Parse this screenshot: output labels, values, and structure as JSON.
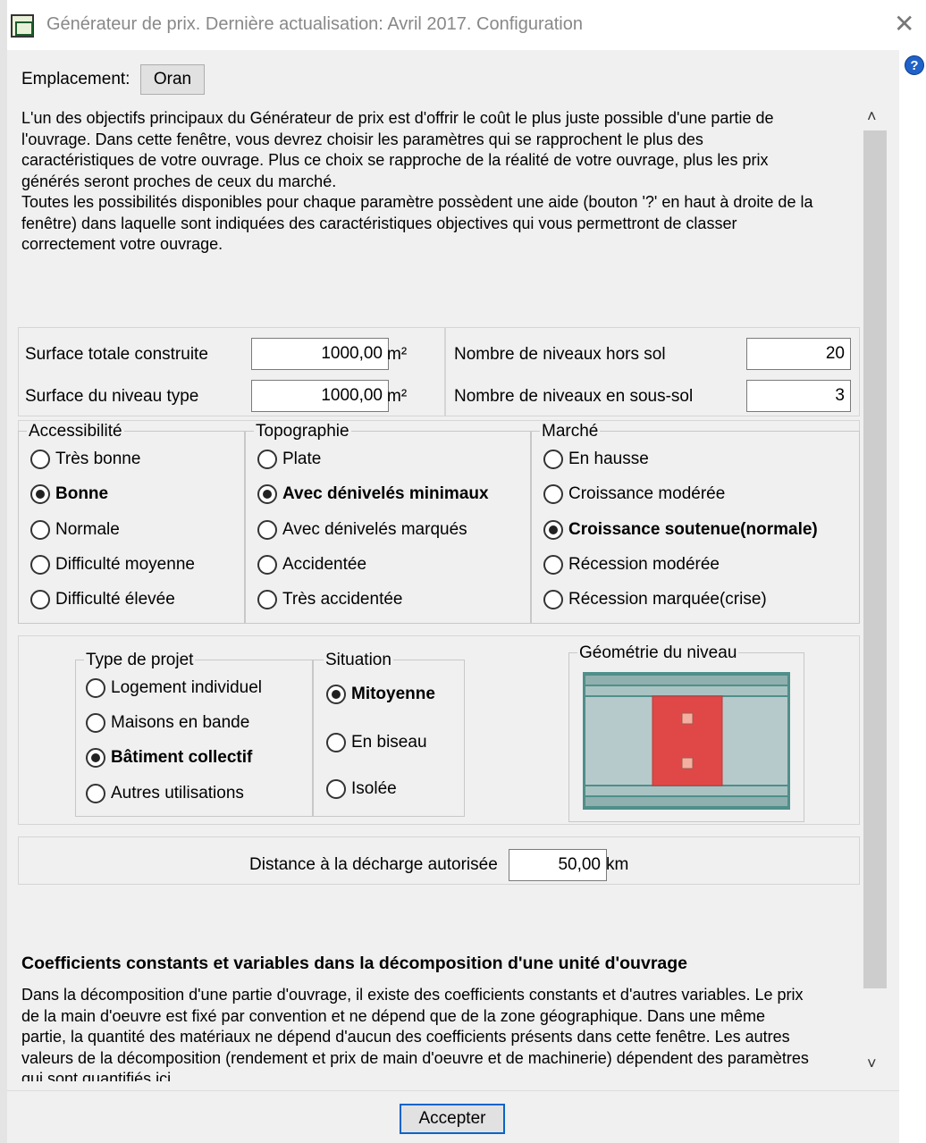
{
  "window": {
    "title": "Générateur de prix. Dernière actualisation: Avril 2017. Configuration",
    "close_glyph": "✕",
    "help_glyph": "?"
  },
  "location": {
    "label": "Emplacement:",
    "value": "Oran"
  },
  "intro": {
    "lines": [
      "L'un des objectifs principaux du Générateur de prix est d'offrir le coût le plus juste possible d'une partie de",
      "l'ouvrage. Dans cette fenêtre, vous devrez choisir les paramètres qui se rapprochent le plus des",
      "caractéristiques de votre ouvrage. Plus ce choix se rapproche de la réalité de votre ouvrage, plus les prix",
      "générés seront proches de ceux du marché.",
      "Toutes les possibilités disponibles pour chaque paramètre possèdent une aide (bouton '?' en haut à droite de la",
      "fenêtre) dans laquelle sont indiquées des caractéristiques objectives qui vous permettront de classer",
      "correctement votre ouvrage."
    ]
  },
  "surfaces": {
    "total_label": "Surface totale construite",
    "total_value": "1000,00",
    "type_label": "Surface du niveau type",
    "type_value": "1000,00",
    "unit": "m²"
  },
  "levels": {
    "above_label": "Nombre de niveaux hors sol",
    "above_value": "20",
    "below_label": "Nombre de niveaux en sous-sol",
    "below_value": "3"
  },
  "accessibility": {
    "title": "Accessibilité",
    "options": [
      "Très bonne",
      "Bonne",
      "Normale",
      "Difficulté moyenne",
      "Difficulté élevée"
    ],
    "selected": "Bonne"
  },
  "topography": {
    "title": "Topographie",
    "options": [
      "Plate",
      "Avec dénivelés minimaux",
      "Avec dénivelés marqués",
      "Accidentée",
      "Très accidentée"
    ],
    "selected": "Avec dénivelés minimaux"
  },
  "market": {
    "title": "Marché",
    "options": [
      "En hausse",
      "Croissance modérée",
      "Croissance soutenue(normale)",
      "Récession modérée",
      "Récession marquée(crise)"
    ],
    "selected": "Croissance soutenue(normale)"
  },
  "project_type": {
    "title": "Type de projet",
    "options": [
      "Logement individuel",
      "Maisons en bande",
      "Bâtiment collectif",
      "Autres utilisations"
    ],
    "selected": "Bâtiment collectif"
  },
  "situation": {
    "title": "Situation",
    "options": [
      "Mitoyenne",
      "En biseau",
      "Isolée"
    ],
    "selected": "Mitoyenne"
  },
  "geometry": {
    "title": "Géométrie du niveau",
    "colors": {
      "outer": "#4f8f8a",
      "band": "#a9c3c3",
      "body": "#b7cacb",
      "building": "#e04848",
      "window": "#f3b0a0"
    }
  },
  "dump_distance": {
    "label": "Distance à la décharge autorisée",
    "value": "50,00",
    "unit": "km"
  },
  "coefficients": {
    "heading": "Coefficients constants et variables dans la décomposition d'une unité d'ouvrage",
    "lines": [
      "Dans la décomposition d'une partie d'ouvrage, il existe des coefficients constants et d'autres variables. Le prix",
      "de la main d'oeuvre est fixé par convention et ne dépend que de la zone géographique. Dans une même",
      "partie, la quantité des matériaux ne dépend d'aucun des coefficients présents dans cette fenêtre. Les autres",
      "valeurs de la décomposition (rendement et prix de main d'oeuvre et de machinerie) dépendent des paramètres",
      "qui sont quantifiés ici."
    ]
  },
  "scroll": {
    "up_glyph": "˄",
    "down_glyph": "˅"
  },
  "footer": {
    "accept_label": "Accepter"
  }
}
